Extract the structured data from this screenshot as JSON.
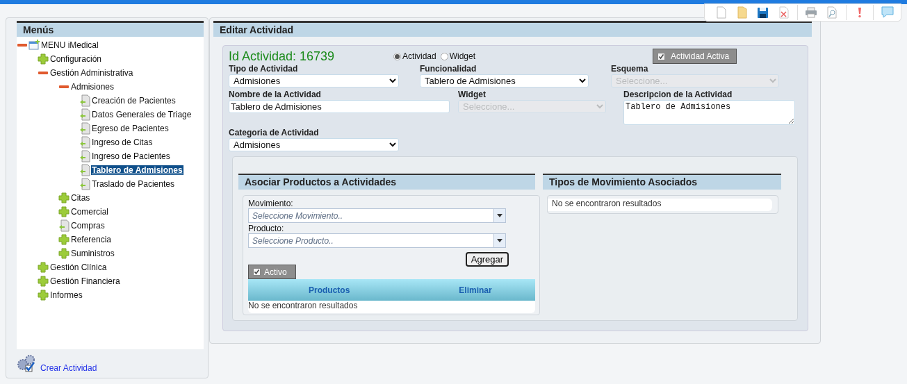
{
  "sidebar": {
    "title": "Menús",
    "tree": [
      {
        "label": "MENU iMedical",
        "kind": "root",
        "expanded": true,
        "children": [
          {
            "label": "Configuración",
            "kind": "folder",
            "expanded": false
          },
          {
            "label": "Gestión Administrativa",
            "kind": "folder",
            "expanded": true,
            "children": [
              {
                "label": "Admisiones",
                "kind": "folder",
                "expanded": true,
                "children": [
                  {
                    "label": "Creación de Pacientes",
                    "kind": "page",
                    "selected": false
                  },
                  {
                    "label": "Datos Generales de Triage",
                    "kind": "page",
                    "selected": false
                  },
                  {
                    "label": "Egreso de Pacientes",
                    "kind": "page",
                    "selected": false
                  },
                  {
                    "label": "Ingreso de Citas",
                    "kind": "page",
                    "selected": false
                  },
                  {
                    "label": "Ingreso de Pacientes",
                    "kind": "page",
                    "selected": false
                  },
                  {
                    "label": "Tablero de Admisiones",
                    "kind": "page",
                    "selected": true
                  },
                  {
                    "label": "Traslado de Pacientes",
                    "kind": "page",
                    "selected": false
                  }
                ]
              },
              {
                "label": "Citas",
                "kind": "folder",
                "expanded": false
              },
              {
                "label": "Comercial",
                "kind": "folder",
                "expanded": false
              },
              {
                "label": "Compras",
                "kind": "page",
                "selected": false
              },
              {
                "label": "Referencia",
                "kind": "folder",
                "expanded": false
              },
              {
                "label": "Suministros",
                "kind": "folder",
                "expanded": false
              }
            ]
          },
          {
            "label": "Gestión Clínica",
            "kind": "folder",
            "expanded": false
          },
          {
            "label": "Gestión Financiera",
            "kind": "folder",
            "expanded": false
          },
          {
            "label": "Informes",
            "kind": "folder",
            "expanded": false
          }
        ]
      }
    ],
    "create_link": "Crear Actividad"
  },
  "editor": {
    "title": "Editar Actividad",
    "id_label": "Id Actividad: 16739",
    "type_radios": [
      {
        "label": "Actividad",
        "selected": true
      },
      {
        "label": "Widget",
        "selected": false
      }
    ],
    "active_toggle": {
      "label": "Actividad Activa",
      "checked": true
    },
    "tipo": {
      "label": "Tipo de Actividad",
      "value": "Admisiones",
      "disabled": false
    },
    "funcionalidad": {
      "label": "Funcionalidad",
      "value": "Tablero de Admisiones",
      "disabled": false
    },
    "esquema": {
      "label": "Esquema",
      "value": "Seleccione...",
      "disabled": true
    },
    "nombre": {
      "label": "Nombre de la Actividad",
      "value": "Tablero de Admisiones"
    },
    "widget": {
      "label": "Widget",
      "value": "Seleccione...",
      "disabled": true
    },
    "descripcion": {
      "label": "Descripcion de la Actividad",
      "value": "Tablero de Admisiones"
    },
    "categoria": {
      "label": "Categoria de Actividad",
      "value": "Admisiones",
      "disabled": false
    }
  },
  "products": {
    "title": "Asociar Productos a Actividades",
    "movimiento": {
      "label": "Movimiento:",
      "placeholder": "Seleccione Movimiento.."
    },
    "producto": {
      "label": "Producto:",
      "placeholder": "Seleccione Producto.."
    },
    "add_button": "Agregar",
    "active_toggle": {
      "label": "Activo",
      "checked": true
    },
    "columns": [
      "Productos",
      "Eliminar"
    ],
    "empty": "No se encontraron resultados"
  },
  "movements": {
    "title": "Tipos de Movimiento Asociados",
    "empty": "No se encontraron resultados"
  }
}
